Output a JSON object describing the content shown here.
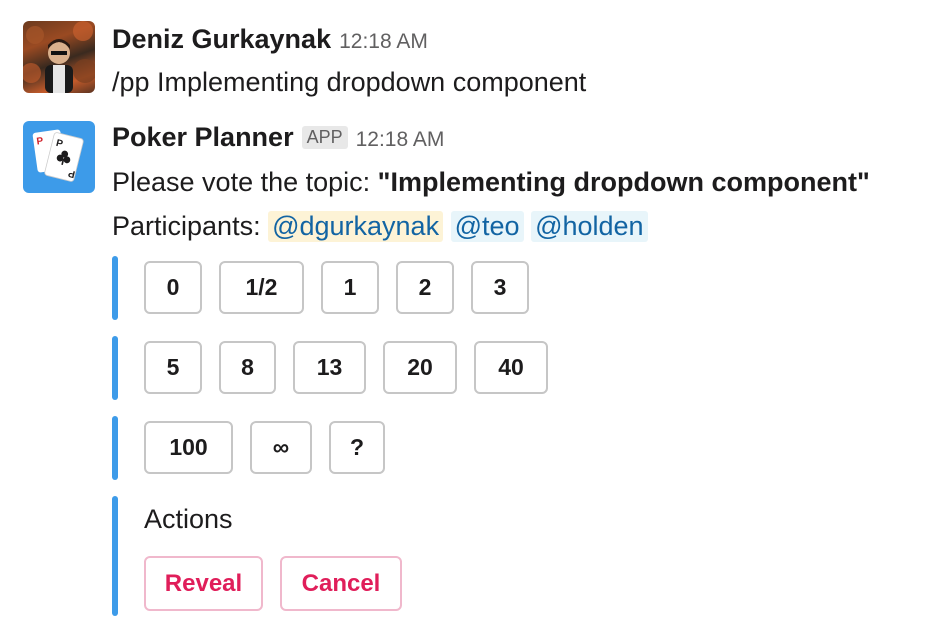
{
  "messages": {
    "user": {
      "sender": "Deniz Gurkaynak",
      "time": "12:18 AM",
      "text": "/pp Implementing dropdown component"
    },
    "bot": {
      "sender": "Poker Planner",
      "badge": "APP",
      "time": "12:18 AM",
      "prompt_prefix": "Please vote the topic: ",
      "topic": "\"Implementing dropdown component\"",
      "participants_label": "Participants: ",
      "participants": [
        "@dgurkaynak",
        "@teo",
        "@holden"
      ],
      "vote_rows": [
        [
          "0",
          "1/2",
          "1",
          "2",
          "3"
        ],
        [
          "5",
          "8",
          "13",
          "20",
          "40"
        ],
        [
          "100",
          "∞",
          "?"
        ]
      ],
      "actions_label": "Actions",
      "actions": [
        "Reveal",
        "Cancel"
      ]
    }
  },
  "colors": {
    "block_bar": "#3d9be9",
    "danger": "#e01e5a",
    "mention": "#1264a3"
  },
  "icons": {
    "bot_avatar": "playing-cards-icon",
    "user_avatar": "user-photo"
  }
}
